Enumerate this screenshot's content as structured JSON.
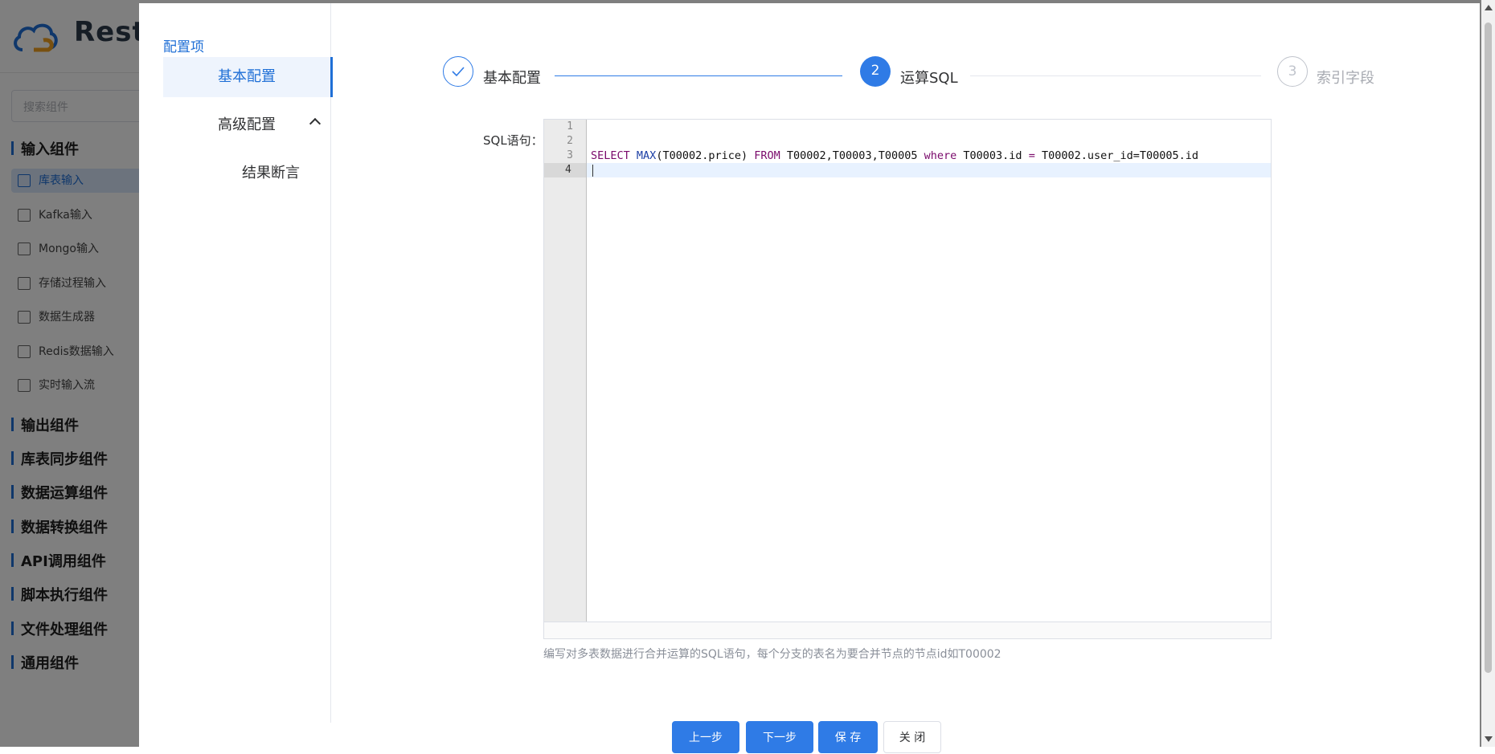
{
  "app": {
    "brand": "Rest",
    "search_placeholder": "搜索组件"
  },
  "sidebar": {
    "groups": [
      "输入组件",
      "输出组件",
      "库表同步组件",
      "数据运算组件",
      "数据转换组件",
      "API调用组件",
      "脚本执行组件",
      "文件处理组件",
      "通用组件"
    ],
    "input_items": [
      "库表输入",
      "Kafka输入",
      "Mongo输入",
      "存储过程输入",
      "数据生成器",
      "Redis数据输入",
      "实时输入流"
    ]
  },
  "dialog": {
    "config_title": "配置项",
    "menu": {
      "basic": "基本配置",
      "advanced": "高级配置",
      "assert": "结果断言"
    },
    "steps": [
      {
        "index": "1",
        "label": "基本配置",
        "status": "finished"
      },
      {
        "index": "2",
        "label": "运算SQL",
        "status": "active"
      },
      {
        "index": "3",
        "label": "索引字段",
        "status": "waiting"
      }
    ],
    "sql_label": "SQL语句：",
    "editor": {
      "line_numbers": [
        "1",
        "2",
        "3",
        "4"
      ],
      "code": {
        "kw_select": "SELECT",
        "fn_max": "MAX",
        "arg": "(T00002.price)",
        "kw_from": "FROM",
        "tables": "T00002,T00003,T00005",
        "kw_where": "where",
        "cond1": "T00003.id",
        "op_eq": "=",
        "cond2": "T00002.user_id=T00005.id"
      }
    },
    "hint": "编写对多表数据进行合并运算的SQL语句，每个分支的表名为要合并节点的节点id如T00002",
    "buttons": {
      "prev": "上一步",
      "next": "下一步",
      "save": "保 存",
      "close": "关 闭"
    }
  },
  "colors": {
    "primary": "#2f7be6",
    "active_step": "#2f7be6",
    "waiting_step": "#c0c4cc"
  }
}
